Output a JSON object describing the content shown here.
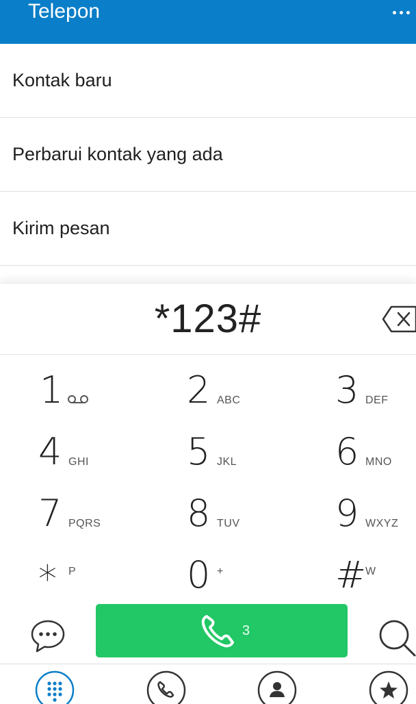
{
  "appbar": {
    "title": "Telepon",
    "overflow_icon": "more-dots-icon"
  },
  "menu": {
    "items": [
      {
        "label": "Kontak baru"
      },
      {
        "label": "Perbarui kontak yang ada"
      },
      {
        "label": "Kirim pesan"
      }
    ]
  },
  "dialer": {
    "number": "*123#",
    "backspace_icon": "backspace-icon",
    "keys": [
      {
        "digit": "1",
        "letters": "",
        "icon": "voicemail-icon"
      },
      {
        "digit": "2",
        "letters": "ABC"
      },
      {
        "digit": "3",
        "letters": "DEF"
      },
      {
        "digit": "4",
        "letters": "GHI"
      },
      {
        "digit": "5",
        "letters": "JKL"
      },
      {
        "digit": "6",
        "letters": "MNO"
      },
      {
        "digit": "7",
        "letters": "PQRS"
      },
      {
        "digit": "8",
        "letters": "TUV"
      },
      {
        "digit": "9",
        "letters": "WXYZ"
      },
      {
        "digit": "*",
        "letters": "P"
      },
      {
        "digit": "0",
        "letters": "+"
      },
      {
        "digit": "#",
        "letters": "W"
      }
    ],
    "call": {
      "sim_label": "3",
      "color": "#22c766"
    }
  },
  "bottom_nav": {
    "tabs": [
      {
        "icon": "dialpad-icon",
        "active": true
      },
      {
        "icon": "call-log-icon"
      },
      {
        "icon": "contacts-icon"
      },
      {
        "icon": "favorites-star-icon"
      }
    ]
  },
  "colors": {
    "accent": "#0a7ec8",
    "call": "#22c766"
  }
}
